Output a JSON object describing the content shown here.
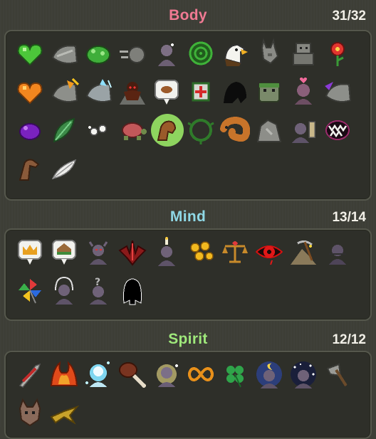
{
  "sections": [
    {
      "title": "Body",
      "count": "31/32",
      "title_color": "#f07a93",
      "items": [
        "green-heart-icon",
        "gray-stone-shield-icon",
        "green-frog-blob-icon",
        "gray-speed-boulder-icon",
        "gray-spark-bust-icon",
        "green-swirl-shell-icon",
        "eagle-head-icon",
        "gray-donkey-icon",
        "gray-golem-icon",
        "red-flower-icon",
        "orange-heart-icon",
        "orange-stone-shield-icon",
        "ice-stone-shield-icon",
        "dark-monkey-mountain-icon",
        "meat-thought-icon",
        "medkit-vine-icon",
        "black-shadow-beast-icon",
        "mossy-golem-head-icon",
        "pink-heart-bust-icon",
        "purple-stone-shield-icon",
        "purple-blob-icon",
        "green-leaf-icon",
        "white-orbs-icon",
        "turtle-icon",
        "flexed-arm-icon",
        "thorny-vine-icon",
        "orange-worm-icon",
        "gray-rock-icon",
        "battery-bust-icon",
        "fanged-maw-icon",
        "brown-arm-icon",
        "white-feather-icon"
      ],
      "selected_index": 24
    },
    {
      "title": "Mind",
      "count": "13/14",
      "title_color": "#8fd8e6",
      "items": [
        "crown-thought-icon",
        "house-thought-icon",
        "horned-bust-icon",
        "red-demon-icon",
        "candle-bust-icon",
        "gold-coins-icon",
        "balance-scale-icon",
        "red-eye-icon",
        "pickaxe-mountain-icon",
        "dark-bust-icon",
        "pinwheel-icon",
        "halo-bust-icon",
        "question-bust-icon",
        "black-silhouette-icon"
      ]
    },
    {
      "title": "Spirit",
      "count": "12/12",
      "title_color": "#9fe87b",
      "items": [
        "red-dagger-icon",
        "flame-wings-icon",
        "blue-spirit-icon",
        "meat-club-icon",
        "glowing-bust-icon",
        "infinity-icon",
        "four-leaf-clover-icon",
        "moon-night-bust-icon",
        "starry-bust-icon",
        "stone-axe-icon",
        "horned-creature-icon",
        "golden-bird-icon"
      ]
    }
  ]
}
